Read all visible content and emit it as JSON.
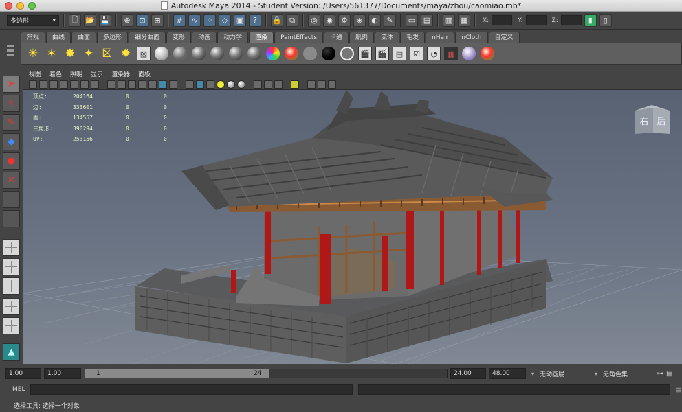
{
  "window": {
    "title": "Autodesk Maya 2014 - Student Version: /Users/561377/Documents/maya/zhou/caomiao.mb*"
  },
  "status_line": {
    "menu_set": "多边形",
    "x_label": "X:",
    "y_label": "Y:",
    "z_label": "Z:"
  },
  "shelf": {
    "tabs": [
      "常规",
      "曲线",
      "曲面",
      "多边形",
      "细分曲面",
      "变形",
      "动画",
      "动力学",
      "渲染",
      "PaintEffects",
      "卡通",
      "肌肉",
      "流体",
      "毛发",
      "nHair",
      "nCloth",
      "自定义"
    ],
    "active_tab": "渲染"
  },
  "panel": {
    "menus": [
      "视图",
      "着色",
      "照明",
      "显示",
      "渲染器",
      "面板"
    ]
  },
  "hud": {
    "rows": [
      {
        "label": "顶点:",
        "total": "204164",
        "selected": "0",
        "component": "0"
      },
      {
        "label": "边:",
        "total": "333601",
        "selected": "0",
        "component": "0"
      },
      {
        "label": "面:",
        "total": "134557",
        "selected": "0",
        "component": "0"
      },
      {
        "label": "三角形:",
        "total": "390294",
        "selected": "0",
        "component": "0"
      },
      {
        "label": "UV:",
        "total": "253156",
        "selected": "0",
        "component": "0"
      }
    ]
  },
  "viewcube": {
    "face_right": "右",
    "face_back": "后"
  },
  "time_slider": {
    "start_time": "1.00",
    "playback_start": "1.00",
    "range_start": "1",
    "range_end": "24",
    "playback_end": "24.00",
    "end_time": "48.00",
    "anim_layer": "无动画层",
    "character_set": "无角色集"
  },
  "command_line": {
    "label": "MEL"
  },
  "help_line": {
    "text": "选择工具: 选择一个对象"
  },
  "colors": {
    "pillar_red": "#b01818",
    "roof_grey": "#5a5a5a",
    "wood_brown": "#8a5a32",
    "stone_grey": "#6a6a6a",
    "hud_text": "#e8f2c0"
  }
}
